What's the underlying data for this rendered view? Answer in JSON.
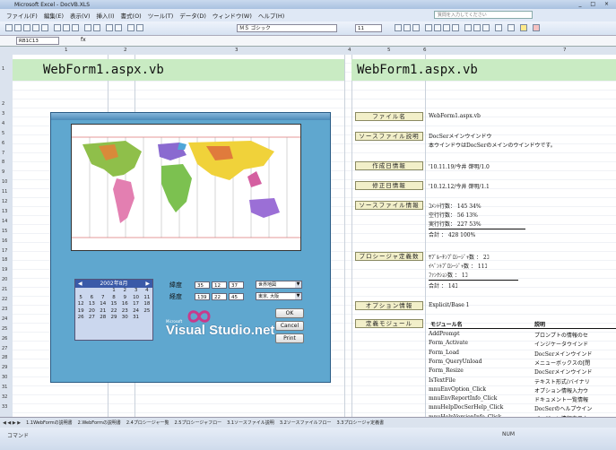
{
  "window": {
    "title": "Microsoft Excel - DocVB.XLS"
  },
  "menu": [
    "ファイル(F)",
    "編集(E)",
    "表示(V)",
    "挿入(I)",
    "書式(O)",
    "ツール(T)",
    "データ(D)",
    "ウィンドウ(W)",
    "ヘルプ(H)"
  ],
  "help_placeholder": "質問を入力してください",
  "toolbar": {
    "font": "ＭＳ ゴシック",
    "size": "11"
  },
  "formula": {
    "cell_ref": "RB1C13",
    "fx": "fx"
  },
  "columns": [
    "1",
    "2",
    "3",
    "4",
    "5",
    "6",
    "7"
  ],
  "rows": [
    "1",
    "2",
    "3",
    "4",
    "5",
    "6",
    "7",
    "8",
    "9",
    "10",
    "11",
    "12",
    "13",
    "14",
    "15",
    "16",
    "17",
    "18",
    "19",
    "20",
    "21",
    "22",
    "23",
    "24",
    "25",
    "26",
    "27",
    "28",
    "29",
    "30",
    "31",
    "32",
    "33"
  ],
  "left_title": "WebForm1.aspx.vb",
  "right_title": "WebForm1.aspx.vb",
  "info": {
    "file_name_label": "ファイル名",
    "file_name": "WebForm1.aspx.vb",
    "desc_label": "ソースファイル説明",
    "desc_1": "DocSerメインウインドウ",
    "desc_2": "本ウインドウはDocSerのメインのウインドウです。",
    "created_label": "作成日情報",
    "created": "'10.11.19/今井 啓明/1.0",
    "modified_label": "修正日情報",
    "modified": "'10.12.12/今井 啓明/1.1",
    "srcinfo_label": "ソースファイル情報",
    "comment_lines": "ｺﾒﾝﾄ行数：  145   34%",
    "blank_lines": "空行行数：   56   13%",
    "exec_lines": "実行行数：  227   53%",
    "total_lines": "合計    ：  428  100%",
    "proc_label": "プロシージャ定義数",
    "sub_proc": "ｻﾌﾞﾙｰﾁﾝﾌﾟﾛｼｰｼﾞｬ数 ：   2ｺ",
    "event_proc": "ｲﾍﾞﾝﾄﾌﾟﾛｼｰｼﾞｬ数 ：  11ｺ",
    "func_count": "ﾌｧﾝｸｼｮﾝ数      ：   1ｺ",
    "proc_total": "合計           ：  14ｺ",
    "option_label": "オプション情報",
    "option": "Explicit/Base 1",
    "module_label": "定義モジュール",
    "module_col": "モジュール名",
    "desc_col": "説明",
    "modules": [
      {
        "name": "AddPrompt",
        "desc": "プロンプトの情報のセ"
      },
      {
        "name": "Form_Activate",
        "desc": "インジケータウインド"
      },
      {
        "name": "Form_Load",
        "desc": "DocSerメインウインド"
      },
      {
        "name": "Form_QueryUnload",
        "desc": "メニューボックスの[閉"
      },
      {
        "name": "Form_Resize",
        "desc": "DocSerメインウインド"
      },
      {
        "name": "IsTextFile",
        "desc": "テキスト形式/バイナリ"
      },
      {
        "name": "mnuEnvOption_Click",
        "desc": "オプション情報入力ウ"
      },
      {
        "name": "mnuEnvReportInfo_Click",
        "desc": "ドキュメント一覧情報"
      },
      {
        "name": "mnuHelpDocSerHelp_Click",
        "desc": "DocSerのヘルプウイン"
      },
      {
        "name": "mnuHelpVersionInfo_Click",
        "desc": "バージョン情報表示ウ"
      }
    ]
  },
  "form": {
    "calendar_title": "2002年8月",
    "calendar_days": [
      "",
      "",
      "",
      "1",
      "2",
      "3",
      "4",
      "5",
      "6",
      "7",
      "8",
      "9",
      "10",
      "11",
      "12",
      "13",
      "14",
      "15",
      "16",
      "17",
      "18",
      "19",
      "20",
      "21",
      "22",
      "23",
      "24",
      "25",
      "26",
      "27",
      "28",
      "29",
      "30",
      "31"
    ],
    "lat_label": "緯度",
    "lon_label": "経度",
    "lat_vals": [
      "35",
      "12",
      "37"
    ],
    "lon_vals": [
      "139",
      "22",
      "45"
    ],
    "map_select": "世界地図",
    "city_select": "東京, 大阪",
    "ok": "OK",
    "cancel": "Cancel",
    "print": "Print",
    "vs_small": "Microsoft",
    "vs_logo": "Visual Studio.net"
  },
  "sheet_tabs": [
    "1.1WebFormの説明書",
    "2.WebFormの説明書",
    "2.4プロシージャ一覧",
    "2.5プロシージャフロー",
    "3.1ソースファイル説明",
    "3.2ソースファイルフロー",
    "3.3プロシージャ定義書"
  ],
  "status": {
    "left": "コマンド",
    "right": "NUM"
  }
}
